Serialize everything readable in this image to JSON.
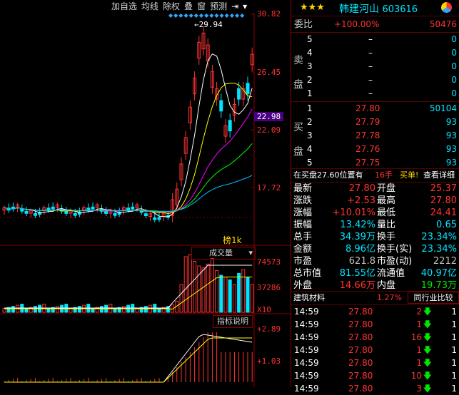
{
  "toolbar": {
    "items": [
      "加自选",
      "均线",
      "除权",
      "叠",
      "窗",
      "预测"
    ]
  },
  "price_axis": {
    "top": "30.82",
    "mid1": "26.45",
    "current": "22.98",
    "mid2": "22.09",
    "bottom": "17.72"
  },
  "annotation": {
    "high": "29.94"
  },
  "pane_labels": {
    "candle_type": "榜1k",
    "volume": "成交量",
    "indicator": "指标说明"
  },
  "volume_axis": {
    "top": "74573",
    "mid": "37286",
    "unit": "X10"
  },
  "indicator_axis": {
    "top": "+2.89",
    "mid": "+1.03"
  },
  "stock": {
    "name": "韩建河山",
    "code": "603616",
    "stars": "★★★"
  },
  "weibi": {
    "label": "委比",
    "pct": "+100.00%",
    "diff": "50476"
  },
  "sell_side": {
    "label_top": "卖",
    "label_bottom": "盘",
    "levels": [
      {
        "n": "5",
        "price": "–",
        "vol": "0"
      },
      {
        "n": "4",
        "price": "–",
        "vol": "0"
      },
      {
        "n": "3",
        "price": "–",
        "vol": "0"
      },
      {
        "n": "2",
        "price": "–",
        "vol": "0"
      },
      {
        "n": "1",
        "price": "–",
        "vol": "0"
      }
    ]
  },
  "buy_side": {
    "label_top": "买",
    "label_bottom": "盘",
    "levels": [
      {
        "n": "1",
        "price": "27.80",
        "vol": "50104"
      },
      {
        "n": "2",
        "price": "27.79",
        "vol": "93"
      },
      {
        "n": "3",
        "price": "27.78",
        "vol": "93"
      },
      {
        "n": "4",
        "price": "27.76",
        "vol": "93"
      },
      {
        "n": "5",
        "price": "27.75",
        "vol": "93"
      }
    ]
  },
  "pending": {
    "text": "在买盘27.60位置有",
    "count": "16手",
    "action": "买单!",
    "link": "查看详细"
  },
  "stats": [
    {
      "l1": "最新",
      "v1": "27.80",
      "l2": "开盘",
      "v2": "25.37",
      "c1": "red",
      "c2": "red"
    },
    {
      "l1": "涨跌",
      "v1": "+2.53",
      "l2": "最高",
      "v2": "27.80",
      "c1": "red",
      "c2": "red"
    },
    {
      "l1": "涨幅",
      "v1": "+10.01%",
      "l2": "最低",
      "v2": "24.41",
      "c1": "red",
      "c2": "red"
    },
    {
      "l1": "振幅",
      "v1": "13.42%",
      "l2": "量比",
      "v2": "0.65",
      "c1": "cyan",
      "c2": "cyan"
    },
    {
      "l1": "总手",
      "v1": "34.39万",
      "l2": "换手",
      "v2": "23.34%",
      "c1": "cyan",
      "c2": "cyan"
    },
    {
      "l1": "金额",
      "v1": "8.96亿",
      "l2": "换手(实)",
      "v2": "23.34%",
      "c1": "cyan",
      "c2": "cyan"
    },
    {
      "l1": "市盈",
      "v1": "621.8",
      "l2": "市盈(动)",
      "v2": "2212",
      "c1": "gray",
      "c2": "gray"
    },
    {
      "l1": "总市值",
      "v1": "81.55亿",
      "l2": "流通值",
      "v2": "40.97亿",
      "c1": "cyan",
      "c2": "cyan"
    },
    {
      "l1": "外盘",
      "v1": "14.66万",
      "l2": "内盘",
      "v2": "19.73万",
      "c1": "red",
      "c2": "green"
    }
  ],
  "sector": {
    "name": "建筑材料",
    "pct": "1.27%",
    "compare": "同行业比较"
  },
  "ticks": [
    {
      "time": "14:59",
      "price": "27.80",
      "vol": "2",
      "n": "1"
    },
    {
      "time": "14:59",
      "price": "27.80",
      "vol": "1",
      "n": "1"
    },
    {
      "time": "14:59",
      "price": "27.80",
      "vol": "16",
      "n": "1"
    },
    {
      "time": "14:59",
      "price": "27.80",
      "vol": "1",
      "n": "1"
    },
    {
      "time": "14:59",
      "price": "27.80",
      "vol": "1",
      "n": "1"
    },
    {
      "time": "14:59",
      "price": "27.80",
      "vol": "10",
      "n": "1"
    },
    {
      "time": "14:59",
      "price": "27.80",
      "vol": "3",
      "n": "1"
    }
  ],
  "colors": {
    "up": "#ff3232",
    "down": "#00e5ff",
    "bg": "#000000",
    "grid": "#8b0000",
    "ma5": "#ffffff",
    "ma10": "#ffff00",
    "ma20": "#ff00ff",
    "ma30": "#00ff00",
    "ma60": "#00bfff"
  }
}
